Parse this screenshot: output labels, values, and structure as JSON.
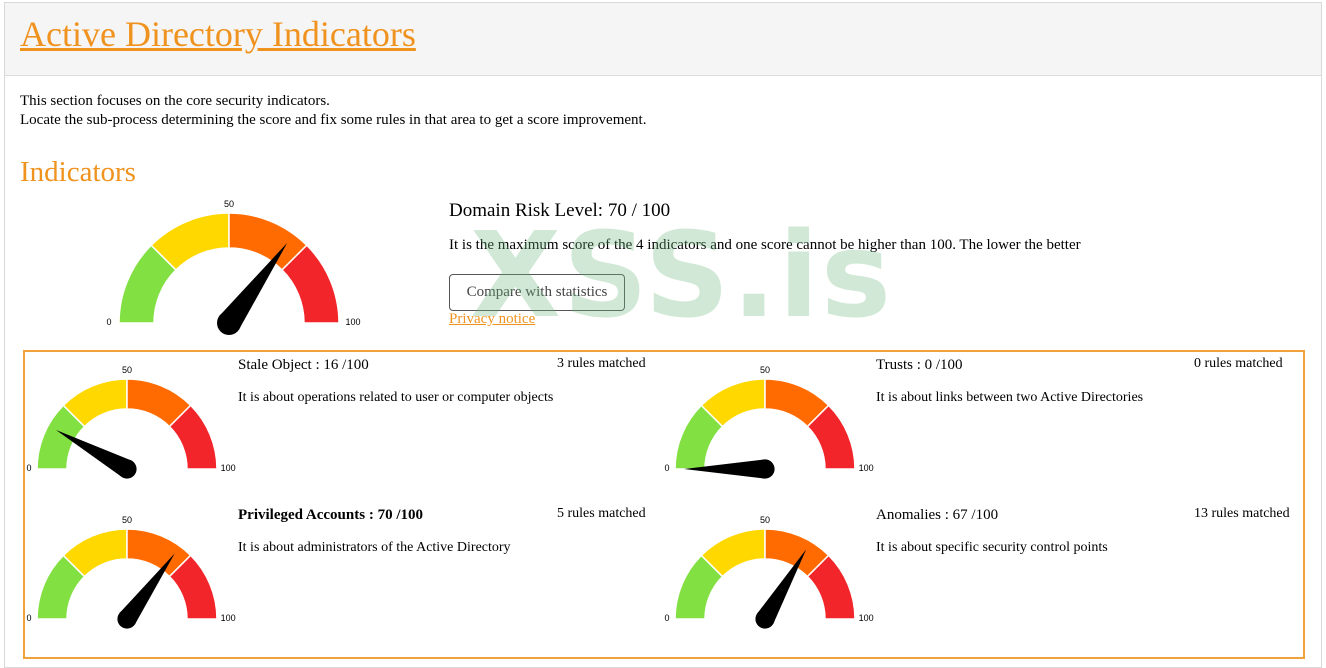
{
  "page": {
    "title": "Active Directory Indicators"
  },
  "intro": {
    "line1": "This section focuses on the core security indicators.",
    "line2": "Locate the sub-process determining the score and fix some rules in that area to get a score improvement."
  },
  "section": {
    "title": "Indicators"
  },
  "gauge_scale": {
    "min": "0",
    "mid": "50",
    "max": "100"
  },
  "gauge_colors": [
    "#83e043",
    "#ffd800",
    "#ff6b00",
    "#f2262a"
  ],
  "main": {
    "risk_label": "Domain Risk Level: 70 / 100",
    "score": 70,
    "description": "It is the maximum score of the 4 indicators and one score cannot be higher than 100. The lower the better",
    "compare_button": "Compare with statistics",
    "privacy_link": "Privacy notice"
  },
  "indicators": [
    {
      "title": "Stale Object : 16 /100",
      "score": 16,
      "rules": "3 rules matched",
      "description": "It is about operations related to user or computer objects"
    },
    {
      "title": "Trusts : 0 /100",
      "score": 0,
      "rules": "0 rules matched",
      "description": "It is about links between two Active Directories"
    },
    {
      "title": "Privileged Accounts : 70 /100",
      "score": 70,
      "rules": "5 rules matched",
      "description": "It is about administrators of the Active Directory"
    },
    {
      "title": "Anomalies : 67 /100",
      "score": 67,
      "rules": "13 rules matched",
      "description": "It is about specific security control points"
    }
  ],
  "watermark": {
    "text": "XSS.is"
  }
}
